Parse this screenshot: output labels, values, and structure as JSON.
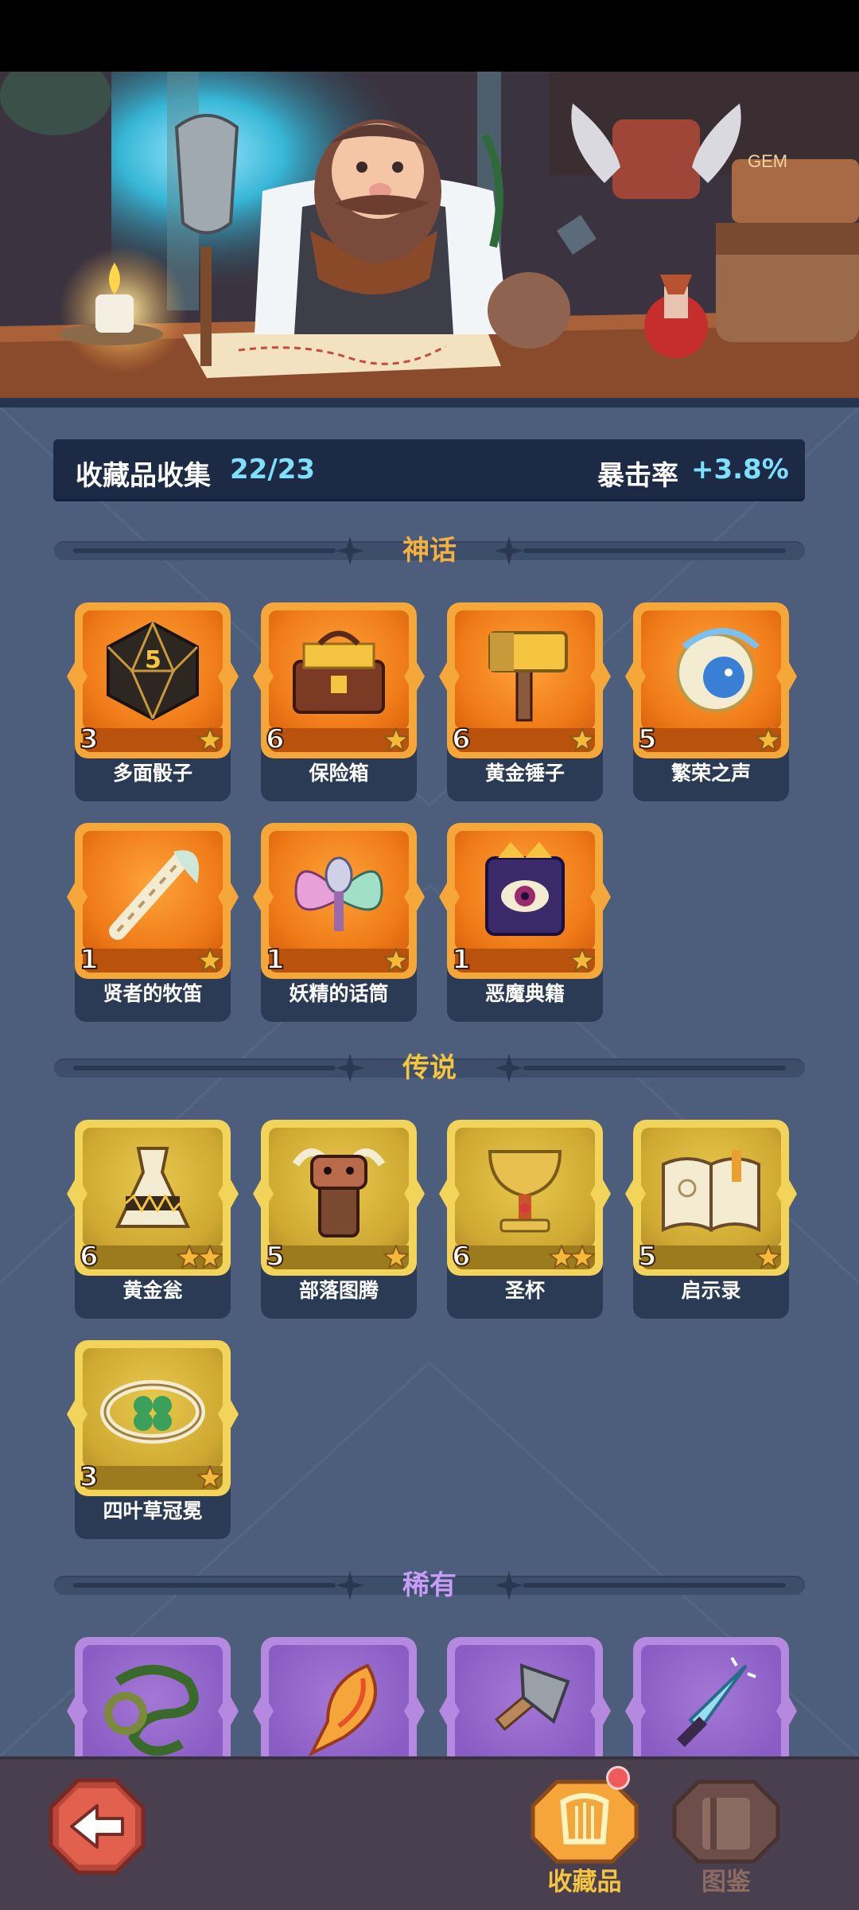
{
  "summary": {
    "collection_label": "收藏品收集",
    "collection_value": "22/23",
    "crit_label": "暴击率",
    "crit_value": "+3.8%"
  },
  "sections": {
    "mythic": {
      "title": "神话",
      "color": "#f5b042"
    },
    "legendary": {
      "title": "传说",
      "color": "#f5c542"
    },
    "rare": {
      "title": "稀有",
      "color": "#c79cf5"
    }
  },
  "mythic_items": [
    {
      "name": "多面骰子",
      "count": "3",
      "stars": 1,
      "icon": "d20-dice-icon"
    },
    {
      "name": "保险箱",
      "count": "6",
      "stars": 1,
      "icon": "treasure-chest-icon"
    },
    {
      "name": "黄金锤子",
      "count": "6",
      "stars": 1,
      "icon": "golden-hammer-icon"
    },
    {
      "name": "繁荣之声",
      "count": "5",
      "stars": 1,
      "icon": "conch-shell-icon"
    },
    {
      "name": "贤者的牧笛",
      "count": "1",
      "stars": 1,
      "icon": "pan-flute-icon"
    },
    {
      "name": "妖精的话筒",
      "count": "1",
      "stars": 1,
      "icon": "fairy-microphone-icon"
    },
    {
      "name": "恶魔典籍",
      "count": "1",
      "stars": 1,
      "icon": "demon-book-icon"
    }
  ],
  "legendary_items": [
    {
      "name": "黄金瓮",
      "count": "6",
      "stars": 2,
      "icon": "golden-urn-icon"
    },
    {
      "name": "部落图腾",
      "count": "5",
      "stars": 1,
      "icon": "tribal-totem-icon"
    },
    {
      "name": "圣杯",
      "count": "6",
      "stars": 2,
      "icon": "holy-grail-icon"
    },
    {
      "name": "启示录",
      "count": "5",
      "stars": 1,
      "icon": "open-book-icon"
    },
    {
      "name": "四叶草冠冕",
      "count": "3",
      "stars": 1,
      "icon": "clover-crown-icon"
    }
  ],
  "rare_items": [
    {
      "icon": "thorn-vine-icon"
    },
    {
      "icon": "flame-feather-icon"
    },
    {
      "icon": "stone-axe-icon"
    },
    {
      "icon": "ice-dagger-icon"
    }
  ],
  "nav": {
    "collection_label": "收藏品",
    "codex_label": "图鉴"
  },
  "colors": {
    "panel": "#4c5e7b",
    "summary_bg": "#1d2a45",
    "accent_cyan": "#7ee0ff",
    "nav_active": "#f5c542",
    "nav_inactive": "#8c6b62"
  }
}
